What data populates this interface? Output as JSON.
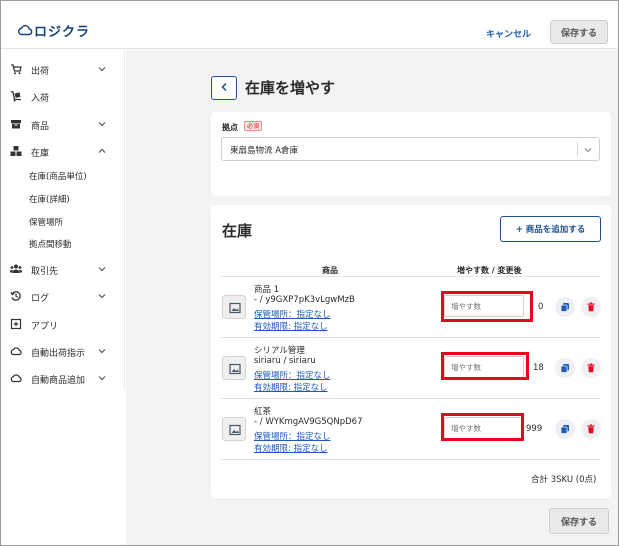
{
  "header": {
    "logo_text": "ロジクラ",
    "cancel_label": "キャンセル",
    "save_label": "保存する"
  },
  "sidebar": {
    "items": [
      {
        "label": "出荷",
        "icon": "cart-icon",
        "expandable": true
      },
      {
        "label": "入荷",
        "icon": "dolly-icon",
        "expandable": false
      },
      {
        "label": "商品",
        "icon": "box-icon",
        "expandable": true
      },
      {
        "label": "在庫",
        "icon": "boxes-icon",
        "expandable": true
      },
      {
        "label": "取引先",
        "icon": "users-icon",
        "expandable": true
      },
      {
        "label": "ログ",
        "icon": "history-icon",
        "expandable": true
      },
      {
        "label": "アプリ",
        "icon": "plus-square-icon",
        "expandable": false
      },
      {
        "label": "自動出荷指示",
        "icon": "cloud-icon",
        "expandable": true
      },
      {
        "label": "自動商品追加",
        "icon": "cloud-icon",
        "expandable": true
      }
    ],
    "stock_sub_items": [
      "在庫(商品単位)",
      "在庫(詳細)",
      "保管場所",
      "拠点間移動"
    ]
  },
  "page": {
    "title": "在庫を増やす",
    "location_label": "拠点",
    "required_badge": "必須",
    "location_value": "東扇島物流 A倉庫"
  },
  "stock": {
    "section_title": "在庫",
    "add_button": "+ 商品を追加する",
    "col_product": "商品",
    "col_increase": "増やす数 / 変更後",
    "rows": [
      {
        "name": "商品 1",
        "sku": "- / y9GXP7pK3vLgwMzB",
        "location": "保管場所：指定なし",
        "expiry": "有効期限: 指定なし",
        "placeholder": "増やす数",
        "after": "0"
      },
      {
        "name": "シリアル管理",
        "sku": "siriaru / siriaru",
        "location": "保管場所：指定なし",
        "expiry": "有効期限: 指定なし",
        "placeholder": "増やす数",
        "after": "18"
      },
      {
        "name": "紅茶",
        "sku": "- / WYKmgAV9G5QNpD67",
        "location": "保管場所：指定なし",
        "expiry": "有効期限: 指定なし",
        "placeholder": "増やす数",
        "after": "999"
      }
    ],
    "total": "合計 3SKU (0点)"
  },
  "footer": {
    "save_label": "保存する"
  },
  "colors": {
    "brand": "#15417a",
    "link": "#1e5bb8",
    "highlight": "#e5091f",
    "delete": "#e5091f",
    "copy": "#1e5bb8"
  }
}
